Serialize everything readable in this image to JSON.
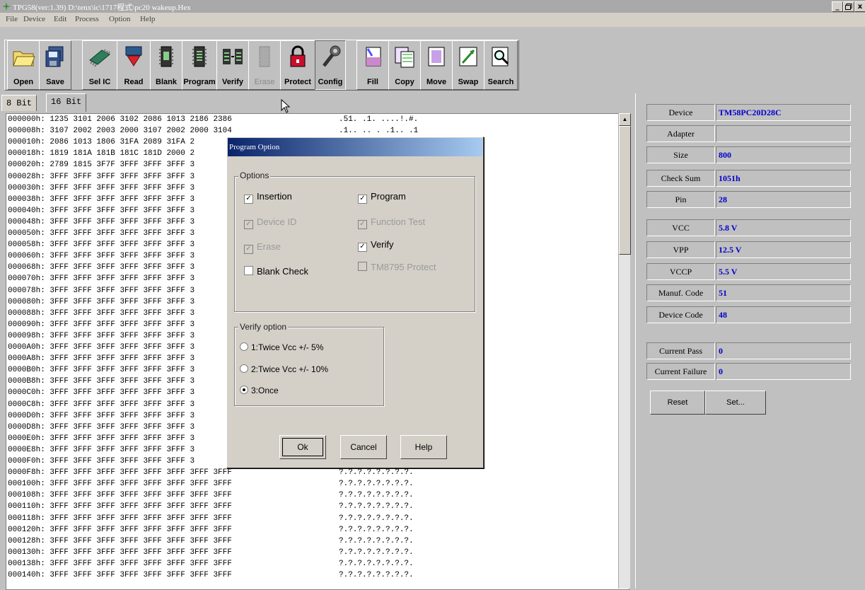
{
  "window": {
    "title": "TPG58(ver:1.39) D:\\tenx\\ic\\1717程式\\pc20 wakeup.Hex",
    "controls": [
      "_",
      " ",
      "x"
    ]
  },
  "menu": [
    "File",
    "Device",
    "Edit",
    "Process",
    "Option",
    "Help"
  ],
  "toolbar": [
    {
      "label": "Open",
      "icon": "folder-icon"
    },
    {
      "label": "Save",
      "icon": "save-icon"
    },
    {
      "label": "Sel IC",
      "icon": "chip-icon"
    },
    {
      "label": "Read",
      "icon": "read-icon"
    },
    {
      "label": "Blank",
      "icon": "blank-icon"
    },
    {
      "label": "Program",
      "icon": "program-icon"
    },
    {
      "label": "Verify",
      "icon": "verify-icon"
    },
    {
      "label": "Erase",
      "icon": "erase-icon",
      "disabled": true
    },
    {
      "label": "Protect",
      "icon": "lock-icon"
    },
    {
      "label": "Config",
      "icon": "wrench-icon",
      "pressed": true
    },
    {
      "label": "Fill",
      "icon": "fill-icon"
    },
    {
      "label": "Copy",
      "icon": "copy-icon"
    },
    {
      "label": "Move",
      "icon": "move-icon"
    },
    {
      "label": "Swap",
      "icon": "swap-icon"
    },
    {
      "label": "Search",
      "icon": "search-icon"
    }
  ],
  "tabs": [
    "8 Bit",
    "16 Bit"
  ],
  "hex": {
    "rows": [
      {
        "addr": "000000h:",
        "words": "1235 3101 2006 3102 2086 1013 2186 2386",
        "ascii": ".51. .1. ....!.#."
      },
      {
        "addr": "000008h:",
        "words": "3107 2002 2003 2000 3107 2002 2000 3104",
        "ascii": ".1.. .. . .1.. .1"
      },
      {
        "addr": "000010h:",
        "words": "2086 1013 1806 31FA 2089 31FA 2",
        "ascii": ""
      },
      {
        "addr": "000018h:",
        "words": "1819 181A 181B 181C 181D 2000 2",
        "ascii": ""
      },
      {
        "addr": "000020h:",
        "words": "2789 1815 3F7F 3FFF 3FFF 3FFF 3",
        "ascii": ""
      },
      {
        "addr": "000028h:",
        "words": "3FFF 3FFF 3FFF 3FFF 3FFF 3FFF 3",
        "ascii": ""
      },
      {
        "addr": "000030h:",
        "words": "3FFF 3FFF 3FFF 3FFF 3FFF 3FFF 3",
        "ascii": ""
      },
      {
        "addr": "000038h:",
        "words": "3FFF 3FFF 3FFF 3FFF 3FFF 3FFF 3",
        "ascii": ""
      },
      {
        "addr": "000040h:",
        "words": "3FFF 3FFF 3FFF 3FFF 3FFF 3FFF 3",
        "ascii": ""
      },
      {
        "addr": "000048h:",
        "words": "3FFF 3FFF 3FFF 3FFF 3FFF 3FFF 3",
        "ascii": ""
      },
      {
        "addr": "000050h:",
        "words": "3FFF 3FFF 3FFF 3FFF 3FFF 3FFF 3",
        "ascii": ""
      },
      {
        "addr": "000058h:",
        "words": "3FFF 3FFF 3FFF 3FFF 3FFF 3FFF 3",
        "ascii": ""
      },
      {
        "addr": "000060h:",
        "words": "3FFF 3FFF 3FFF 3FFF 3FFF 3FFF 3",
        "ascii": ""
      },
      {
        "addr": "000068h:",
        "words": "3FFF 3FFF 3FFF 3FFF 3FFF 3FFF 3",
        "ascii": ""
      },
      {
        "addr": "000070h:",
        "words": "3FFF 3FFF 3FFF 3FFF 3FFF 3FFF 3",
        "ascii": ""
      },
      {
        "addr": "000078h:",
        "words": "3FFF 3FFF 3FFF 3FFF 3FFF 3FFF 3",
        "ascii": ""
      },
      {
        "addr": "000080h:",
        "words": "3FFF 3FFF 3FFF 3FFF 3FFF 3FFF 3",
        "ascii": ""
      },
      {
        "addr": "000088h:",
        "words": "3FFF 3FFF 3FFF 3FFF 3FFF 3FFF 3",
        "ascii": ""
      },
      {
        "addr": "000090h:",
        "words": "3FFF 3FFF 3FFF 3FFF 3FFF 3FFF 3",
        "ascii": ""
      },
      {
        "addr": "000098h:",
        "words": "3FFF 3FFF 3FFF 3FFF 3FFF 3FFF 3",
        "ascii": ""
      },
      {
        "addr": "0000A0h:",
        "words": "3FFF 3FFF 3FFF 3FFF 3FFF 3FFF 3",
        "ascii": ""
      },
      {
        "addr": "0000A8h:",
        "words": "3FFF 3FFF 3FFF 3FFF 3FFF 3FFF 3",
        "ascii": ""
      },
      {
        "addr": "0000B0h:",
        "words": "3FFF 3FFF 3FFF 3FFF 3FFF 3FFF 3",
        "ascii": ""
      },
      {
        "addr": "0000B8h:",
        "words": "3FFF 3FFF 3FFF 3FFF 3FFF 3FFF 3",
        "ascii": ""
      },
      {
        "addr": "0000C0h:",
        "words": "3FFF 3FFF 3FFF 3FFF 3FFF 3FFF 3",
        "ascii": ""
      },
      {
        "addr": "0000C8h:",
        "words": "3FFF 3FFF 3FFF 3FFF 3FFF 3FFF 3",
        "ascii": ""
      },
      {
        "addr": "0000D0h:",
        "words": "3FFF 3FFF 3FFF 3FFF 3FFF 3FFF 3",
        "ascii": ""
      },
      {
        "addr": "0000D8h:",
        "words": "3FFF 3FFF 3FFF 3FFF 3FFF 3FFF 3",
        "ascii": ""
      },
      {
        "addr": "0000E0h:",
        "words": "3FFF 3FFF 3FFF 3FFF 3FFF 3FFF 3",
        "ascii": ""
      },
      {
        "addr": "0000E8h:",
        "words": "3FFF 3FFF 3FFF 3FFF 3FFF 3FFF 3",
        "ascii": ""
      },
      {
        "addr": "0000F0h:",
        "words": "3FFF 3FFF 3FFF 3FFF 3FFF 3FFF 3",
        "ascii": ""
      },
      {
        "addr": "0000F8h:",
        "words": "3FFF 3FFF 3FFF 3FFF 3FFF 3FFF 3FFF 3FFF",
        "ascii": "?.?.?.?.?.?.?.?."
      },
      {
        "addr": "000100h:",
        "words": "3FFF 3FFF 3FFF 3FFF 3FFF 3FFF 3FFF 3FFF",
        "ascii": "?.?.?.?.?.?.?.?."
      },
      {
        "addr": "000108h:",
        "words": "3FFF 3FFF 3FFF 3FFF 3FFF 3FFF 3FFF 3FFF",
        "ascii": "?.?.?.?.?.?.?.?."
      },
      {
        "addr": "000110h:",
        "words": "3FFF 3FFF 3FFF 3FFF 3FFF 3FFF 3FFF 3FFF",
        "ascii": "?.?.?.?.?.?.?.?."
      },
      {
        "addr": "000118h:",
        "words": "3FFF 3FFF 3FFF 3FFF 3FFF 3FFF 3FFF 3FFF",
        "ascii": "?.?.?.?.?.?.?.?."
      },
      {
        "addr": "000120h:",
        "words": "3FFF 3FFF 3FFF 3FFF 3FFF 3FFF 3FFF 3FFF",
        "ascii": "?.?.?.?.?.?.?.?."
      },
      {
        "addr": "000128h:",
        "words": "3FFF 3FFF 3FFF 3FFF 3FFF 3FFF 3FFF 3FFF",
        "ascii": "?.?.?.?.?.?.?.?."
      },
      {
        "addr": "000130h:",
        "words": "3FFF 3FFF 3FFF 3FFF 3FFF 3FFF 3FFF 3FFF",
        "ascii": "?.?.?.?.?.?.?.?."
      },
      {
        "addr": "000138h:",
        "words": "3FFF 3FFF 3FFF 3FFF 3FFF 3FFF 3FFF 3FFF",
        "ascii": "?.?.?.?.?.?.?.?."
      },
      {
        "addr": "000140h:",
        "words": "3FFF 3FFF 3FFF 3FFF 3FFF 3FFF 3FFF 3FFF",
        "ascii": "?.?.?.?.?.?.?.?."
      }
    ]
  },
  "info_panel": {
    "groups": [
      [
        {
          "label": "Device",
          "value": "TM58PC20D28C"
        },
        {
          "label": "Adapter",
          "value": ""
        },
        {
          "label": "Size",
          "value": "800"
        },
        {
          "label": "Check Sum",
          "value": "1051h"
        },
        {
          "label": "Pin",
          "value": "28"
        }
      ],
      [
        {
          "label": "VCC",
          "value": "5.8 V"
        },
        {
          "label": "VPP",
          "value": "12.5 V"
        },
        {
          "label": "VCCP",
          "value": "5.5 V"
        },
        {
          "label": "Manuf. Code",
          "value": "51"
        },
        {
          "label": "Device Code",
          "value": "48"
        }
      ],
      [
        {
          "label": "Current Pass",
          "value": "0"
        },
        {
          "label": "Current Failure",
          "value": "0"
        }
      ]
    ],
    "buttons": [
      "Reset",
      "Set..."
    ]
  },
  "dialog": {
    "title": "Program Option",
    "options_label": "Options",
    "options": [
      {
        "label": "Insertion",
        "checked": true,
        "enabled": true,
        "mark": "✓"
      },
      {
        "label": "Program",
        "checked": true,
        "enabled": true,
        "mark": "✓"
      },
      {
        "label": "Device ID",
        "checked": true,
        "enabled": false,
        "mark": "✓"
      },
      {
        "label": "Function Test",
        "checked": true,
        "enabled": false,
        "mark": "✓"
      },
      {
        "label": "Erase",
        "checked": true,
        "enabled": false,
        "mark": "✓"
      },
      {
        "label": "Verify",
        "checked": true,
        "enabled": true,
        "mark": "✓"
      },
      {
        "label": "Blank Check",
        "checked": false,
        "enabled": true,
        "mark": ""
      },
      {
        "label": "TM8795 Protect",
        "checked": false,
        "enabled": false,
        "mark": ""
      }
    ],
    "verify_label": "Verify option",
    "verify_options": [
      {
        "label": "1:Twice Vcc +/- 5%",
        "selected": false
      },
      {
        "label": "2:Twice Vcc +/- 10%",
        "selected": false
      },
      {
        "label": "3:Once",
        "selected": true
      }
    ],
    "buttons": [
      "Ok",
      "Cancel",
      "Help"
    ]
  }
}
